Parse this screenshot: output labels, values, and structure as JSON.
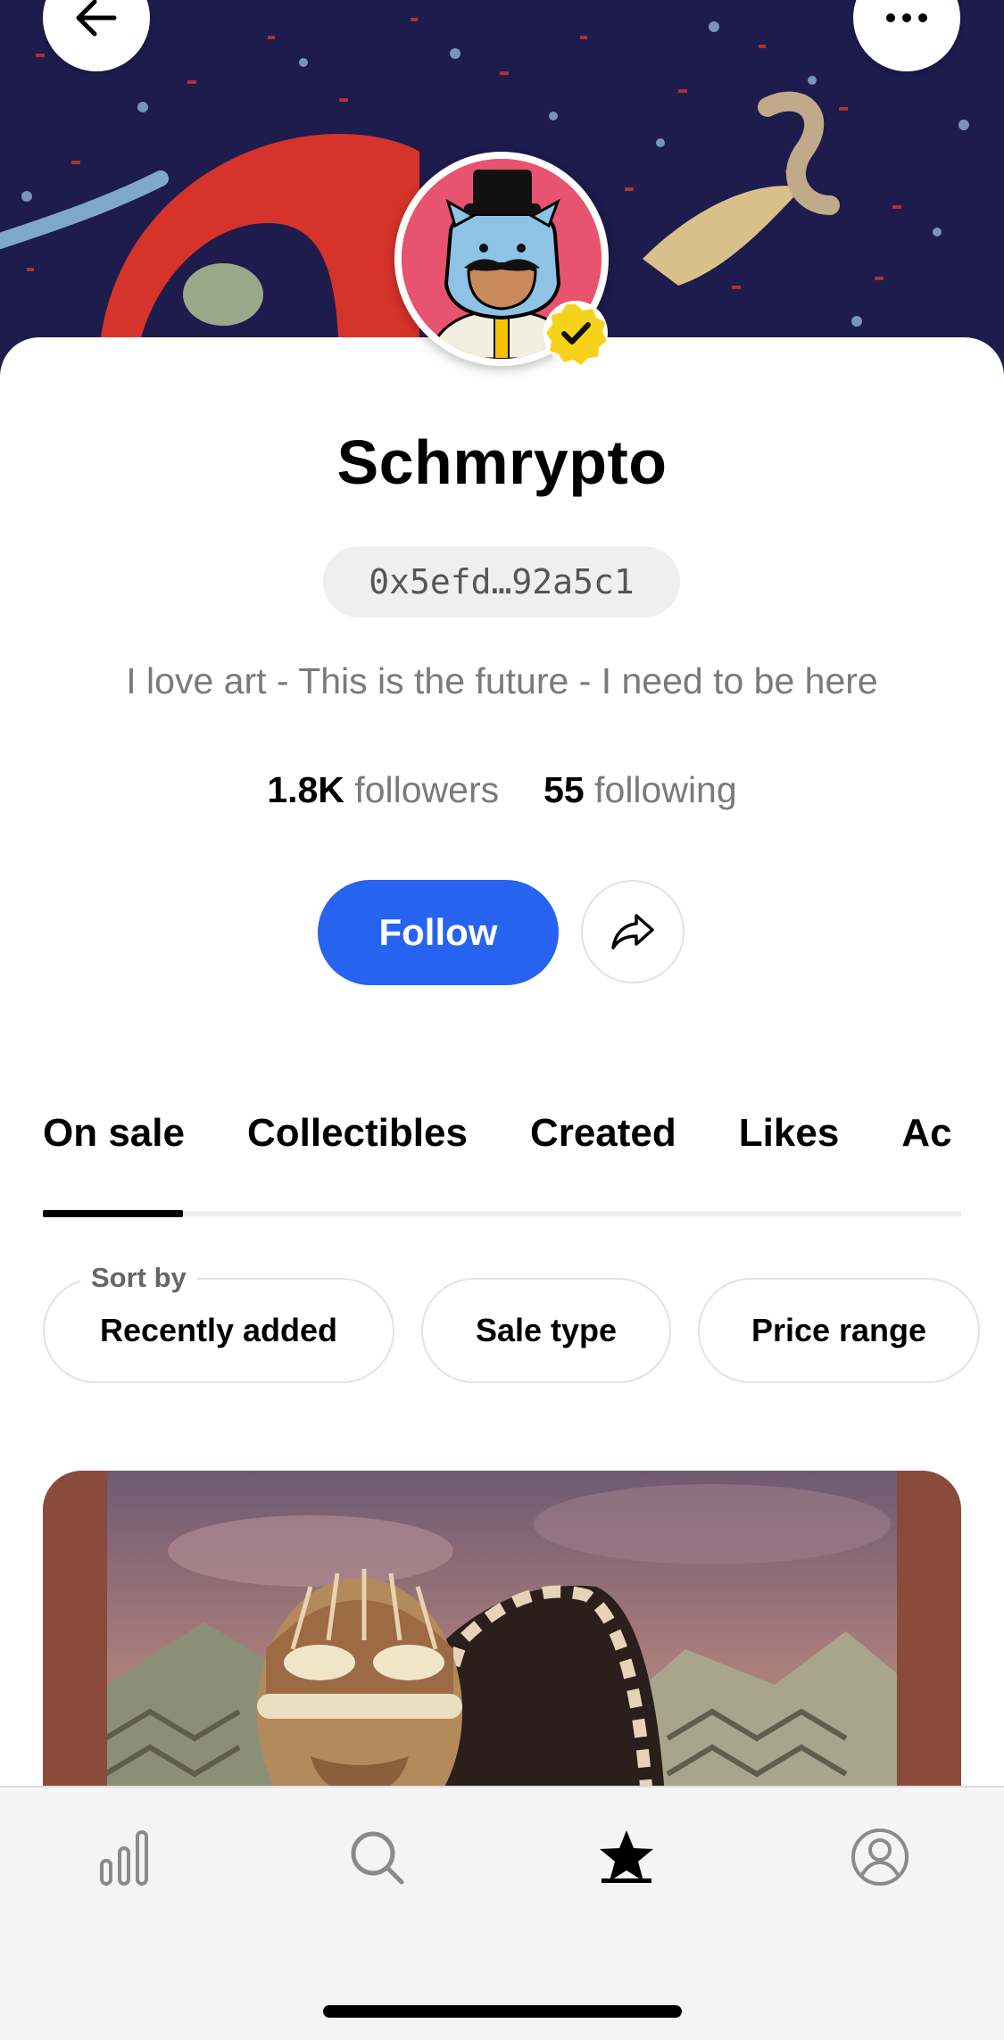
{
  "header": {
    "back_icon": "arrow-left-icon",
    "more_icon": "more-horizontal-icon"
  },
  "profile": {
    "name": "Schmrypto",
    "wallet_address": "0x5efd…92a5c1",
    "bio": "I love art - This is the future - I need to be here",
    "verified": true,
    "followers_count": "1.8K",
    "followers_label": "followers",
    "following_count": "55",
    "following_label": "following"
  },
  "actions": {
    "follow_label": "Follow",
    "follow_color": "#2563f0",
    "share_icon": "share-arrow-icon"
  },
  "tabs": {
    "items": [
      {
        "label": "On sale",
        "active": true
      },
      {
        "label": "Collectibles",
        "active": false
      },
      {
        "label": "Created",
        "active": false
      },
      {
        "label": "Likes",
        "active": false
      },
      {
        "label": "Ac",
        "active": false
      }
    ]
  },
  "filters": {
    "sort_caption": "Sort by",
    "sort_value": "Recently added",
    "sale_type": "Sale type",
    "price_range": "Price range"
  },
  "bottom_nav": {
    "items": [
      {
        "icon": "bar-chart-icon",
        "active": false
      },
      {
        "icon": "search-icon",
        "active": false
      },
      {
        "icon": "star-icon",
        "active": true
      },
      {
        "icon": "user-circle-icon",
        "active": false
      }
    ]
  }
}
